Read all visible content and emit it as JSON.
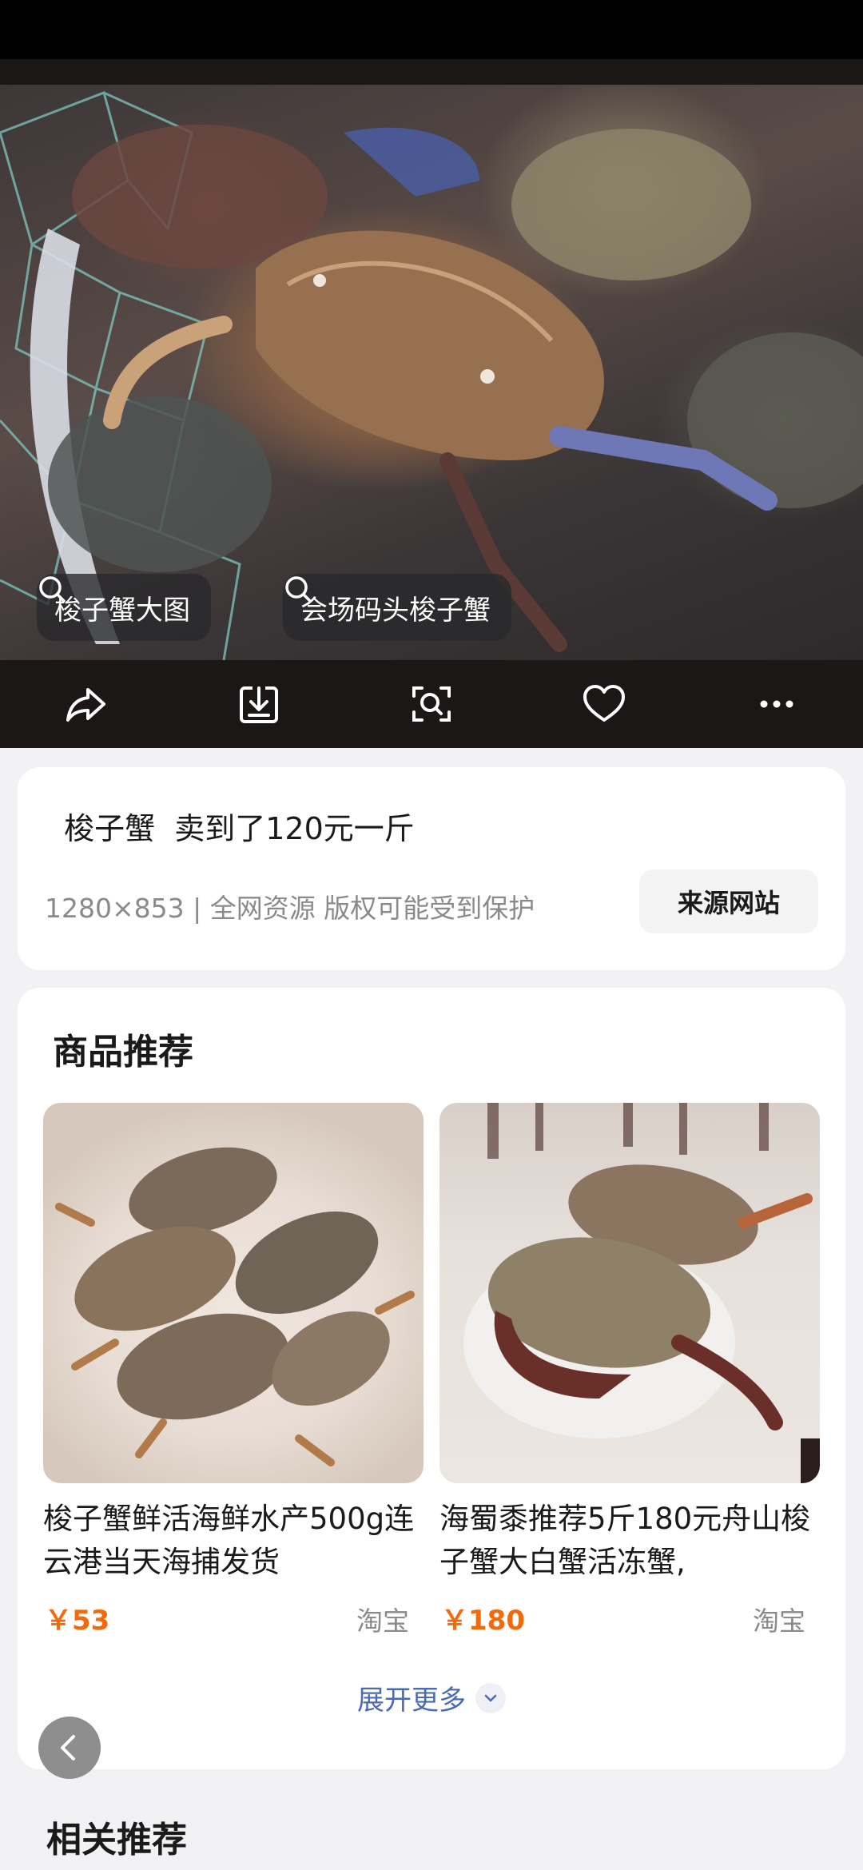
{
  "hero": {
    "search_chips": [
      {
        "label": "梭子蟹大图",
        "icon": "search-icon"
      },
      {
        "label": "会场码头梭子蟹",
        "icon": "search-icon"
      }
    ],
    "actions": [
      {
        "name": "share",
        "icon": "share-icon"
      },
      {
        "name": "download",
        "icon": "download-icon"
      },
      {
        "name": "visual-search",
        "icon": "scan-icon"
      },
      {
        "name": "favorite",
        "icon": "heart-icon"
      },
      {
        "name": "more",
        "icon": "more-icon"
      }
    ]
  },
  "info": {
    "title": " 梭子蟹  卖到了120元一斤",
    "meta": "1280×853 | 全网资源 版权可能受到保护",
    "source_button": "来源网站"
  },
  "products": {
    "section_title": "商品推荐",
    "items": [
      {
        "name": "梭子蟹鲜活海鲜水产500g连云港当天海捕发货",
        "price": "￥53",
        "platform": "淘宝"
      },
      {
        "name": "海蜀黍推荐5斤180元舟山梭子蟹大白蟹活冻蟹,",
        "price": "￥180",
        "platform": "淘宝"
      }
    ],
    "expand_label": "展开更多"
  },
  "related": {
    "title": "相关推荐"
  },
  "colors": {
    "price": "#f26a0c",
    "link": "#4a6bb4",
    "hero_bg": "#1b1716"
  }
}
